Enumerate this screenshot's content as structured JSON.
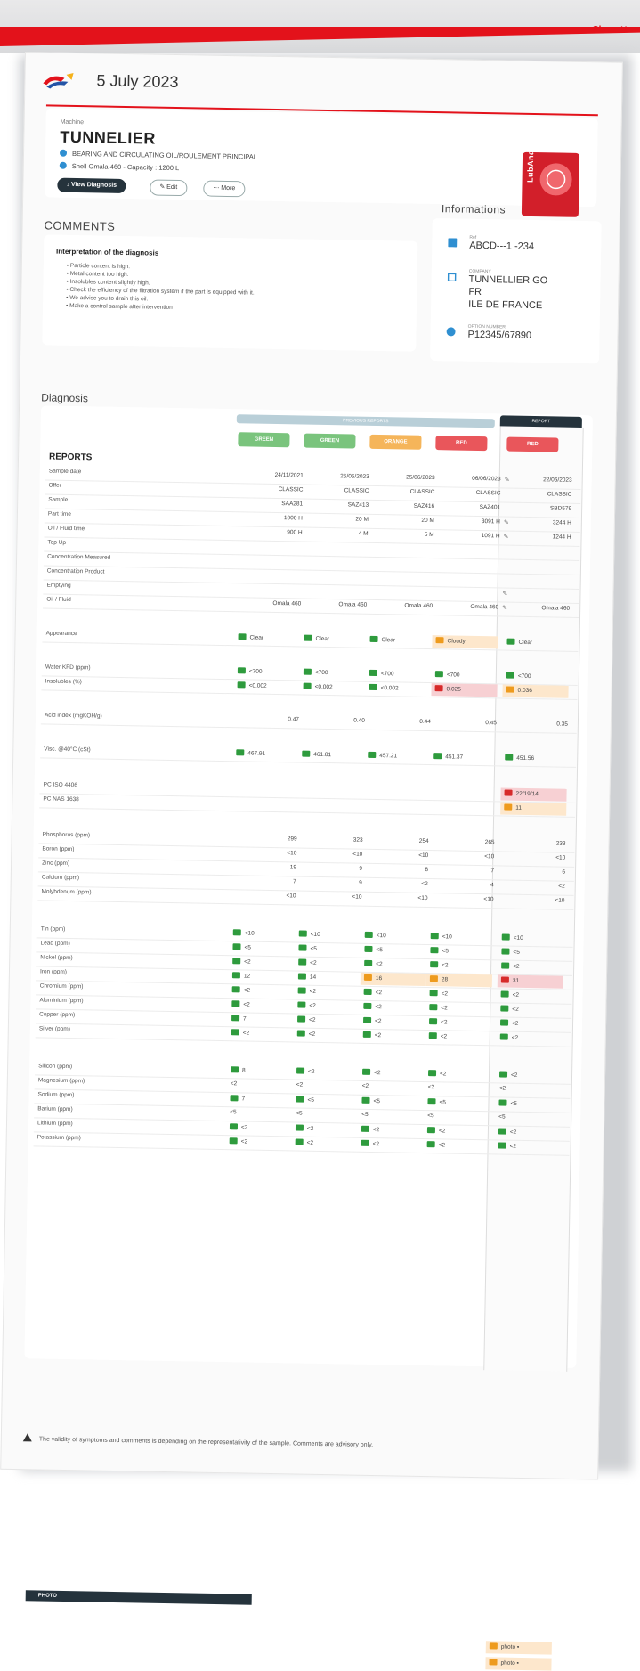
{
  "header": {
    "close_label": "Close",
    "date": "5 July 2023",
    "brand": "TotalEnergies"
  },
  "machine": {
    "label": "Machine",
    "title": "TUNNELIER",
    "component": "BEARING AND CIRCULATING OIL/ROULEMENT PRINCIPAL",
    "oil": "Shell Omala 460 - Capacity : 1200 L",
    "btn_view": "View Diagnosis",
    "btn_edit": "Edit",
    "btn_more": "More",
    "badge": "LubAnac"
  },
  "comments": {
    "title": "COMMENTS",
    "heading": "Interpretation of the diagnosis",
    "items": [
      "Particle content is high.",
      "Metal content too high.",
      "Insolubles content slightly high.",
      "Check the efficiency of the filtration system if the part is equipped with it.",
      "We advise you to drain this oil.",
      "Make a control sample after intervention"
    ]
  },
  "info": {
    "title": "Informations",
    "ref_label": "Ref",
    "ref": "ABCD---1 -234",
    "company_label": "COMPANY",
    "company1": "TUNNELLIER GO",
    "company2": "FR",
    "company3": "ILE DE FRANCE",
    "option_label": "OPTION NUMBER",
    "option": "P12345/67890"
  },
  "diagnosis": {
    "title": "Diagnosis",
    "previous_label": "PREVIOUS REPORTS",
    "report_label": "REPORT",
    "reports_title": "REPORTS",
    "statuses": [
      {
        "label": "GREEN",
        "color": "green"
      },
      {
        "label": "GREEN",
        "color": "green"
      },
      {
        "label": "ORANGE",
        "color": "orange"
      },
      {
        "label": "RED",
        "color": "red"
      },
      {
        "label": "RED",
        "color": "red"
      }
    ],
    "rows": [
      {
        "label": "Sample date",
        "vals": [
          "24/11/2021",
          "25/05/2023",
          "25/06/2023",
          "06/06/2023",
          "22/06/2023"
        ]
      },
      {
        "label": "Offer",
        "vals": [
          "CLASSIC",
          "CLASSIC",
          "CLASSIC",
          "CLASSIC",
          "CLASSIC"
        ]
      },
      {
        "label": "Sample",
        "vals": [
          "SAA281",
          "SAZ413",
          "SAZ416",
          "SAZ401",
          "SBD579"
        ]
      },
      {
        "label": "Part time",
        "vals": [
          "1000 H",
          "20 M",
          "20 M",
          "3091 H",
          "3244 H"
        ]
      },
      {
        "label": "Oil / Fluid time",
        "vals": [
          "900 H",
          "4 M",
          "5 M",
          "1091 H",
          "1244 H"
        ]
      },
      {
        "label": "Top Up",
        "vals": [
          "",
          "",
          "",
          "",
          ""
        ]
      },
      {
        "label": "Concentration Measured",
        "vals": [
          "",
          "",
          "",
          "",
          ""
        ]
      },
      {
        "label": "Concentration Product",
        "vals": [
          "",
          "",
          "",
          "",
          ""
        ]
      },
      {
        "label": "Emptying",
        "vals": [
          "",
          "",
          "",
          "",
          ""
        ]
      },
      {
        "label": "Oil / Fluid",
        "vals": [
          "Omala 460",
          "Omala 460",
          "Omala 460",
          "Omala 460",
          "Omala 460"
        ]
      }
    ],
    "appearance": {
      "label": "Appearance",
      "vals": [
        "Clear",
        "Clear",
        "Clear",
        "Cloudy",
        "Clear"
      ],
      "flags": [
        "g",
        "g",
        "g",
        "o",
        "g"
      ]
    },
    "water": {
      "label": "Water KFD (ppm)",
      "vals": [
        "<700",
        "<700",
        "<700",
        "<700",
        "<700"
      ],
      "flags": [
        "g",
        "g",
        "g",
        "g",
        "g"
      ]
    },
    "insol": {
      "label": "Insolubles (%)",
      "vals": [
        "<0.002",
        "<0.002",
        "<0.002",
        "0.025",
        "0.036"
      ],
      "flags": [
        "g",
        "g",
        "g",
        "r",
        "o"
      ]
    },
    "acid": {
      "label": "Acid index (mgKOH/g)",
      "vals": [
        "0.47",
        "0.40",
        "0.44",
        "0.45",
        "0.35"
      ]
    },
    "visc": {
      "label": "Visc. @40°C (cSt)",
      "vals": [
        "467.91",
        "461.81",
        "457.21",
        "451.37",
        "451.56"
      ],
      "flags": [
        "g",
        "g",
        "g",
        "g",
        "g"
      ]
    },
    "pciso": {
      "label": "PC ISO 4406",
      "val": "22/19/14"
    },
    "pcnas": {
      "label": "PC NAS 1638",
      "val": "11"
    },
    "additives": [
      {
        "label": "Phosphorus (ppm)",
        "vals": [
          "299",
          "323",
          "254",
          "265",
          "233"
        ]
      },
      {
        "label": "Boron (ppm)",
        "vals": [
          "<10",
          "<10",
          "<10",
          "<10",
          "<10"
        ]
      },
      {
        "label": "Zinc (ppm)",
        "vals": [
          "19",
          "9",
          "8",
          "7",
          "6"
        ]
      },
      {
        "label": "Calcium (ppm)",
        "vals": [
          "7",
          "9",
          "<2",
          "4",
          "<2"
        ]
      },
      {
        "label": "Molybdenum (ppm)",
        "vals": [
          "<10",
          "<10",
          "<10",
          "<10",
          "<10"
        ]
      }
    ],
    "wear": [
      {
        "label": "Tin (ppm)",
        "vals": [
          "<10",
          "<10",
          "<10",
          "<10",
          "<10"
        ],
        "flags": [
          "g",
          "g",
          "g",
          "g",
          "g"
        ]
      },
      {
        "label": "Lead (ppm)",
        "vals": [
          "<5",
          "<5",
          "<5",
          "<5",
          "<5"
        ],
        "flags": [
          "g",
          "g",
          "g",
          "g",
          "g"
        ]
      },
      {
        "label": "Nickel (ppm)",
        "vals": [
          "<2",
          "<2",
          "<2",
          "<2",
          "<2"
        ],
        "flags": [
          "g",
          "g",
          "g",
          "g",
          "g"
        ]
      },
      {
        "label": "Iron (ppm)",
        "vals": [
          "12",
          "14",
          "16",
          "28",
          "31"
        ],
        "flags": [
          "g",
          "g",
          "o",
          "o",
          "r"
        ]
      },
      {
        "label": "Chromium (ppm)",
        "vals": [
          "<2",
          "<2",
          "<2",
          "<2",
          "<2"
        ],
        "flags": [
          "g",
          "g",
          "g",
          "g",
          "g"
        ]
      },
      {
        "label": "Aluminium (ppm)",
        "vals": [
          "<2",
          "<2",
          "<2",
          "<2",
          "<2"
        ],
        "flags": [
          "g",
          "g",
          "g",
          "g",
          "g"
        ]
      },
      {
        "label": "Copper (ppm)",
        "vals": [
          "7",
          "<2",
          "<2",
          "<2",
          "<2"
        ],
        "flags": [
          "g",
          "g",
          "g",
          "g",
          "g"
        ]
      },
      {
        "label": "Silver (ppm)",
        "vals": [
          "<2",
          "<2",
          "<2",
          "<2",
          "<2"
        ],
        "flags": [
          "g",
          "g",
          "g",
          "g",
          "g"
        ]
      }
    ],
    "contam": [
      {
        "label": "Silicon (ppm)",
        "vals": [
          "8",
          "<2",
          "<2",
          "<2",
          "<2"
        ],
        "flags": [
          "g",
          "g",
          "g",
          "g",
          "g"
        ]
      },
      {
        "label": "Magnesium (ppm)",
        "vals": [
          "<2",
          "<2",
          "<2",
          "<2",
          "<2"
        ],
        "flags": [
          "",
          "",
          "",
          "",
          ""
        ]
      },
      {
        "label": "Sodium (ppm)",
        "vals": [
          "7",
          "<5",
          "<5",
          "<5",
          "<5"
        ],
        "flags": [
          "g",
          "g",
          "g",
          "g",
          "g"
        ]
      },
      {
        "label": "Barium (ppm)",
        "vals": [
          "<5",
          "<5",
          "<5",
          "<5",
          "<5"
        ],
        "flags": [
          "",
          "",
          "",
          "",
          ""
        ]
      },
      {
        "label": "Lithium (ppm)",
        "vals": [
          "<2",
          "<2",
          "<2",
          "<2",
          "<2"
        ],
        "flags": [
          "g",
          "g",
          "g",
          "g",
          "g"
        ]
      },
      {
        "label": "Potassium (ppm)",
        "vals": [
          "<2",
          "<2",
          "<2",
          "<2",
          "<2"
        ],
        "flags": [
          "g",
          "g",
          "g",
          "g",
          "g"
        ]
      }
    ],
    "photo_label": "PHOTO",
    "photo_links": [
      "photo",
      "photo"
    ]
  },
  "footer": {
    "text": "The validity of symptoms and comments is depending on the representativity of the sample. Comments are advisory only."
  },
  "colors": {
    "brand_red": "#e3121b",
    "dark": "#25333c",
    "green": "#2e9b3d",
    "orange": "#ee9b1e",
    "red": "#d72a2a"
  }
}
